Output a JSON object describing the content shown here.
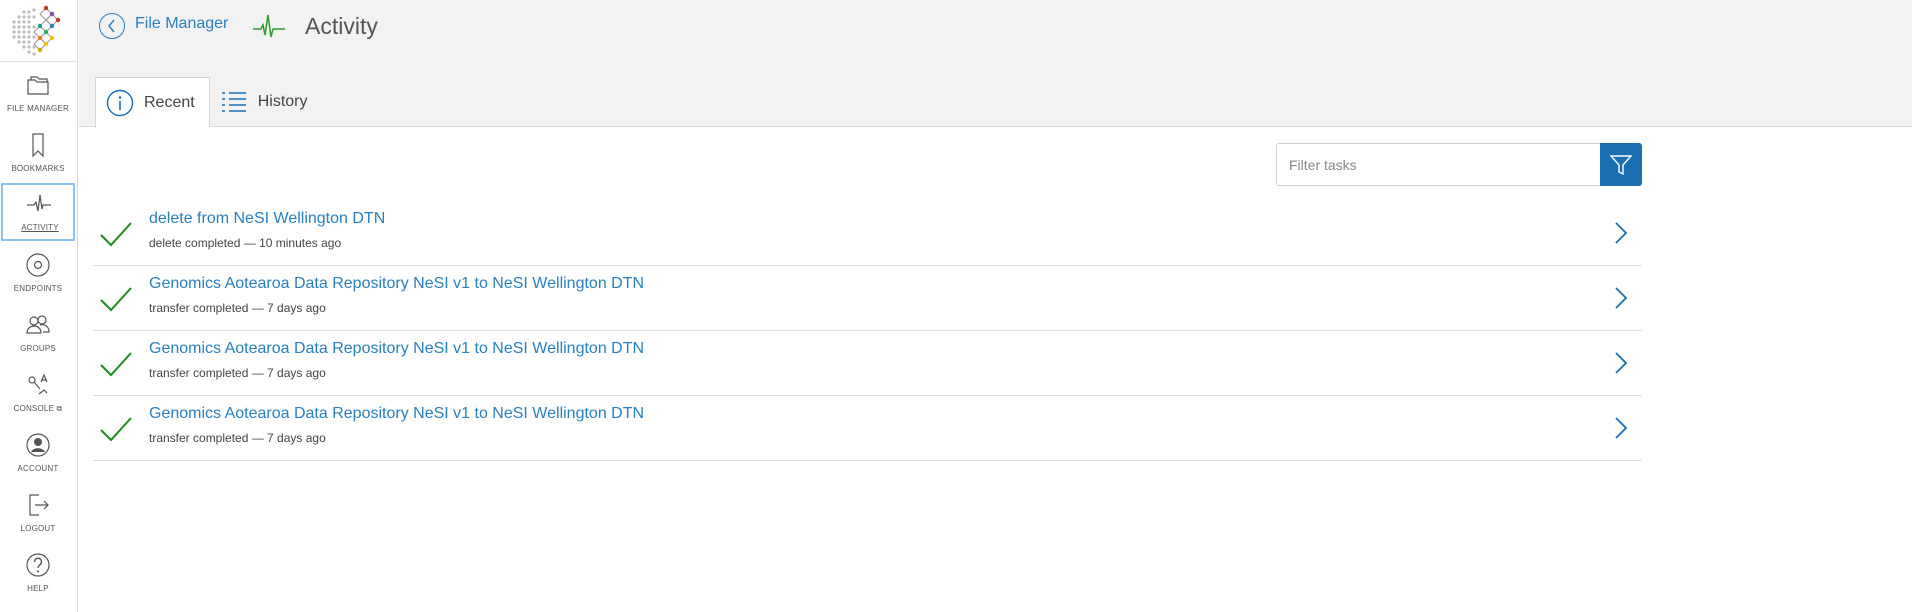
{
  "sidebar": {
    "items": [
      {
        "label": "FILE MANAGER",
        "icon": "folder-icon"
      },
      {
        "label": "BOOKMARKS",
        "icon": "bookmark-icon"
      },
      {
        "label": "ACTIVITY",
        "icon": "pulse-icon"
      },
      {
        "label": "ENDPOINTS",
        "icon": "endpoints-icon"
      },
      {
        "label": "GROUPS",
        "icon": "groups-icon"
      },
      {
        "label": "CONSOLE",
        "icon": "console-icon"
      },
      {
        "label": "ACCOUNT",
        "icon": "account-icon"
      },
      {
        "label": "LOGOUT",
        "icon": "logout-icon"
      },
      {
        "label": "HELP",
        "icon": "help-icon"
      }
    ]
  },
  "header": {
    "back_label": "File Manager",
    "title": "Activity",
    "tabs": [
      {
        "label": "Recent",
        "icon": "info-icon"
      },
      {
        "label": "History",
        "icon": "list-icon"
      }
    ]
  },
  "filter": {
    "placeholder": "Filter tasks"
  },
  "tasks": [
    {
      "title": "delete from NeSI Wellington DTN",
      "status": "delete completed — 10 minutes ago"
    },
    {
      "title": "Genomics Aotearoa Data Repository NeSI v1 to NeSI Wellington DTN",
      "status": "transfer completed — 7 days ago"
    },
    {
      "title": "Genomics Aotearoa Data Repository NeSI v1 to NeSI Wellington DTN",
      "status": "transfer completed — 7 days ago"
    },
    {
      "title": "Genomics Aotearoa Data Repository NeSI v1 to NeSI Wellington DTN",
      "status": "transfer completed — 7 days ago"
    }
  ],
  "colors": {
    "accent": "#2a7fbf",
    "filter_button": "#1a6fb3",
    "success": "#1f8a1f",
    "active_nav_border": "#8fc3ec"
  }
}
